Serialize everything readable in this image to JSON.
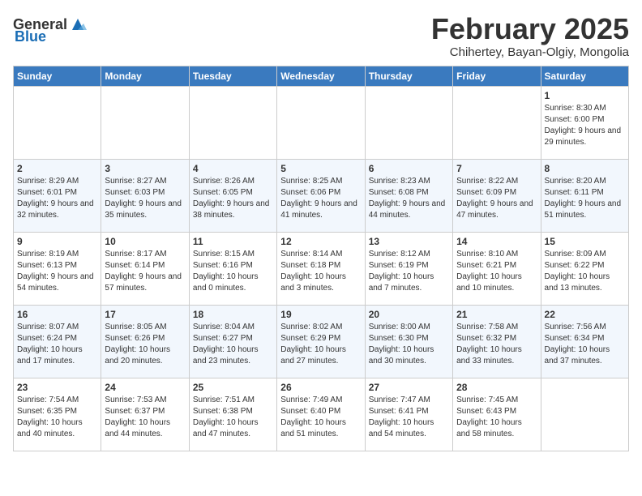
{
  "header": {
    "logo_general": "General",
    "logo_blue": "Blue",
    "month_title": "February 2025",
    "subtitle": "Chihertey, Bayan-Olgiy, Mongolia"
  },
  "days_of_week": [
    "Sunday",
    "Monday",
    "Tuesday",
    "Wednesday",
    "Thursday",
    "Friday",
    "Saturday"
  ],
  "weeks": [
    [
      {
        "num": "",
        "info": ""
      },
      {
        "num": "",
        "info": ""
      },
      {
        "num": "",
        "info": ""
      },
      {
        "num": "",
        "info": ""
      },
      {
        "num": "",
        "info": ""
      },
      {
        "num": "",
        "info": ""
      },
      {
        "num": "1",
        "info": "Sunrise: 8:30 AM\nSunset: 6:00 PM\nDaylight: 9 hours and 29 minutes."
      }
    ],
    [
      {
        "num": "2",
        "info": "Sunrise: 8:29 AM\nSunset: 6:01 PM\nDaylight: 9 hours and 32 minutes."
      },
      {
        "num": "3",
        "info": "Sunrise: 8:27 AM\nSunset: 6:03 PM\nDaylight: 9 hours and 35 minutes."
      },
      {
        "num": "4",
        "info": "Sunrise: 8:26 AM\nSunset: 6:05 PM\nDaylight: 9 hours and 38 minutes."
      },
      {
        "num": "5",
        "info": "Sunrise: 8:25 AM\nSunset: 6:06 PM\nDaylight: 9 hours and 41 minutes."
      },
      {
        "num": "6",
        "info": "Sunrise: 8:23 AM\nSunset: 6:08 PM\nDaylight: 9 hours and 44 minutes."
      },
      {
        "num": "7",
        "info": "Sunrise: 8:22 AM\nSunset: 6:09 PM\nDaylight: 9 hours and 47 minutes."
      },
      {
        "num": "8",
        "info": "Sunrise: 8:20 AM\nSunset: 6:11 PM\nDaylight: 9 hours and 51 minutes."
      }
    ],
    [
      {
        "num": "9",
        "info": "Sunrise: 8:19 AM\nSunset: 6:13 PM\nDaylight: 9 hours and 54 minutes."
      },
      {
        "num": "10",
        "info": "Sunrise: 8:17 AM\nSunset: 6:14 PM\nDaylight: 9 hours and 57 minutes."
      },
      {
        "num": "11",
        "info": "Sunrise: 8:15 AM\nSunset: 6:16 PM\nDaylight: 10 hours and 0 minutes."
      },
      {
        "num": "12",
        "info": "Sunrise: 8:14 AM\nSunset: 6:18 PM\nDaylight: 10 hours and 3 minutes."
      },
      {
        "num": "13",
        "info": "Sunrise: 8:12 AM\nSunset: 6:19 PM\nDaylight: 10 hours and 7 minutes."
      },
      {
        "num": "14",
        "info": "Sunrise: 8:10 AM\nSunset: 6:21 PM\nDaylight: 10 hours and 10 minutes."
      },
      {
        "num": "15",
        "info": "Sunrise: 8:09 AM\nSunset: 6:22 PM\nDaylight: 10 hours and 13 minutes."
      }
    ],
    [
      {
        "num": "16",
        "info": "Sunrise: 8:07 AM\nSunset: 6:24 PM\nDaylight: 10 hours and 17 minutes."
      },
      {
        "num": "17",
        "info": "Sunrise: 8:05 AM\nSunset: 6:26 PM\nDaylight: 10 hours and 20 minutes."
      },
      {
        "num": "18",
        "info": "Sunrise: 8:04 AM\nSunset: 6:27 PM\nDaylight: 10 hours and 23 minutes."
      },
      {
        "num": "19",
        "info": "Sunrise: 8:02 AM\nSunset: 6:29 PM\nDaylight: 10 hours and 27 minutes."
      },
      {
        "num": "20",
        "info": "Sunrise: 8:00 AM\nSunset: 6:30 PM\nDaylight: 10 hours and 30 minutes."
      },
      {
        "num": "21",
        "info": "Sunrise: 7:58 AM\nSunset: 6:32 PM\nDaylight: 10 hours and 33 minutes."
      },
      {
        "num": "22",
        "info": "Sunrise: 7:56 AM\nSunset: 6:34 PM\nDaylight: 10 hours and 37 minutes."
      }
    ],
    [
      {
        "num": "23",
        "info": "Sunrise: 7:54 AM\nSunset: 6:35 PM\nDaylight: 10 hours and 40 minutes."
      },
      {
        "num": "24",
        "info": "Sunrise: 7:53 AM\nSunset: 6:37 PM\nDaylight: 10 hours and 44 minutes."
      },
      {
        "num": "25",
        "info": "Sunrise: 7:51 AM\nSunset: 6:38 PM\nDaylight: 10 hours and 47 minutes."
      },
      {
        "num": "26",
        "info": "Sunrise: 7:49 AM\nSunset: 6:40 PM\nDaylight: 10 hours and 51 minutes."
      },
      {
        "num": "27",
        "info": "Sunrise: 7:47 AM\nSunset: 6:41 PM\nDaylight: 10 hours and 54 minutes."
      },
      {
        "num": "28",
        "info": "Sunrise: 7:45 AM\nSunset: 6:43 PM\nDaylight: 10 hours and 58 minutes."
      },
      {
        "num": "",
        "info": ""
      }
    ]
  ]
}
